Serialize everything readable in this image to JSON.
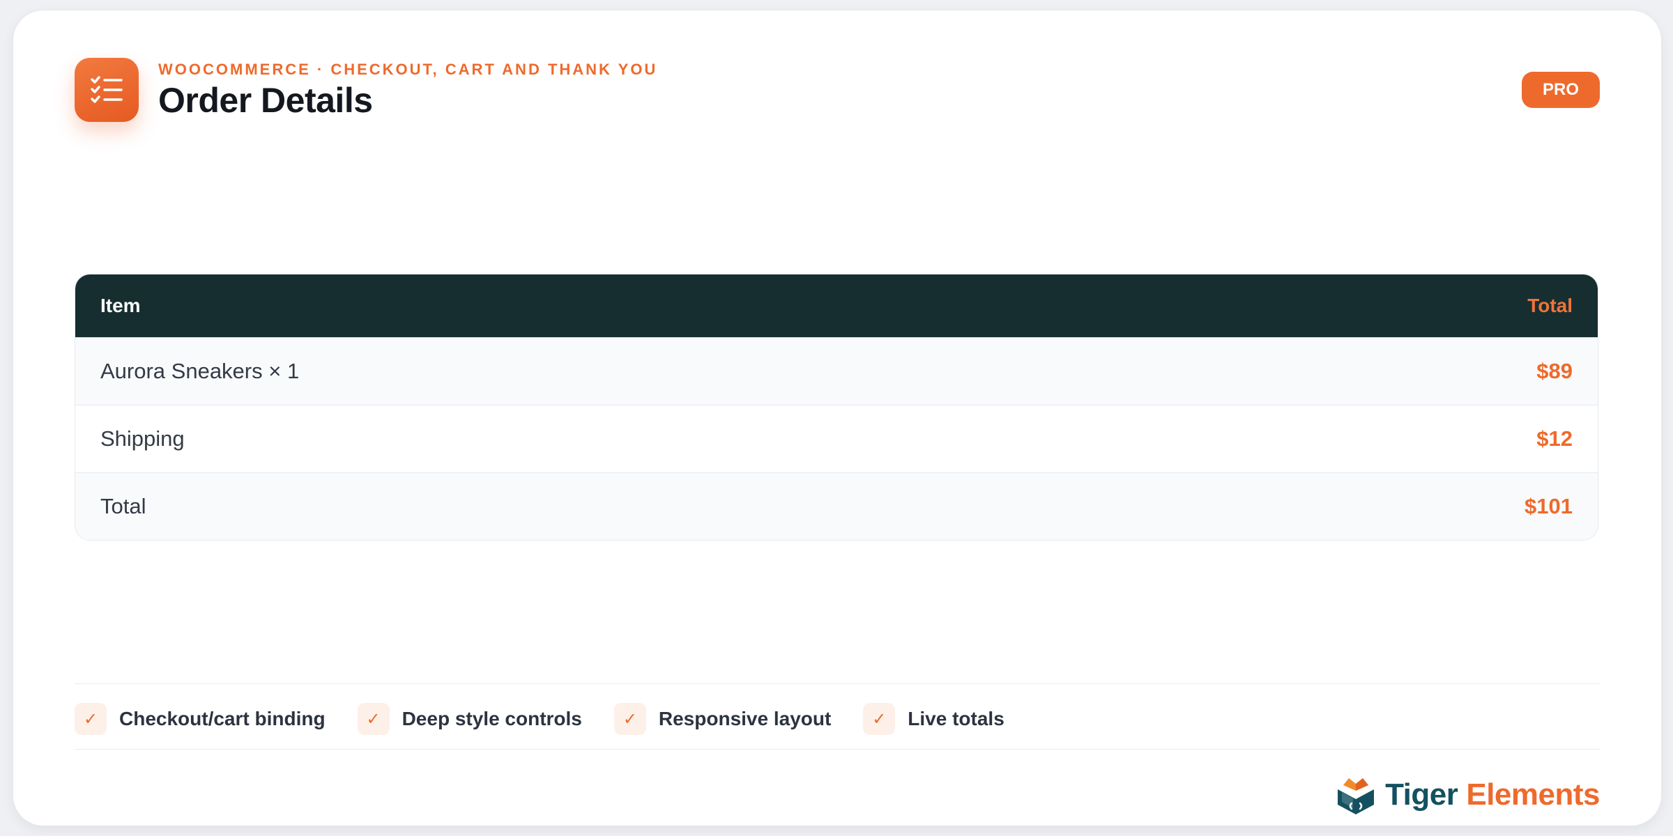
{
  "header": {
    "eyebrow": "WOOCOMMERCE · CHECKOUT, CART AND THANK YOU",
    "title": "Order Details",
    "badge": "PRO",
    "icon": "checklist-icon"
  },
  "table": {
    "columns": [
      "Item",
      "Total"
    ],
    "rows": [
      {
        "label": "Aurora Sneakers × 1",
        "value": "$89"
      },
      {
        "label": "Shipping",
        "value": "$12"
      },
      {
        "label": "Total",
        "value": "$101"
      }
    ]
  },
  "features": [
    {
      "label": "Checkout/cart binding",
      "icon": "check-icon"
    },
    {
      "label": "Deep style controls",
      "icon": "check-icon"
    },
    {
      "label": "Responsive layout",
      "icon": "check-icon"
    },
    {
      "label": "Live totals",
      "icon": "check-icon"
    }
  ],
  "brand": {
    "word1": "Tiger",
    "word2": "Elements",
    "icon": "tiger-logo-icon"
  },
  "colors": {
    "accent": "#ee6a2c",
    "table_header": "#162e30",
    "brand_dark": "#145160"
  }
}
